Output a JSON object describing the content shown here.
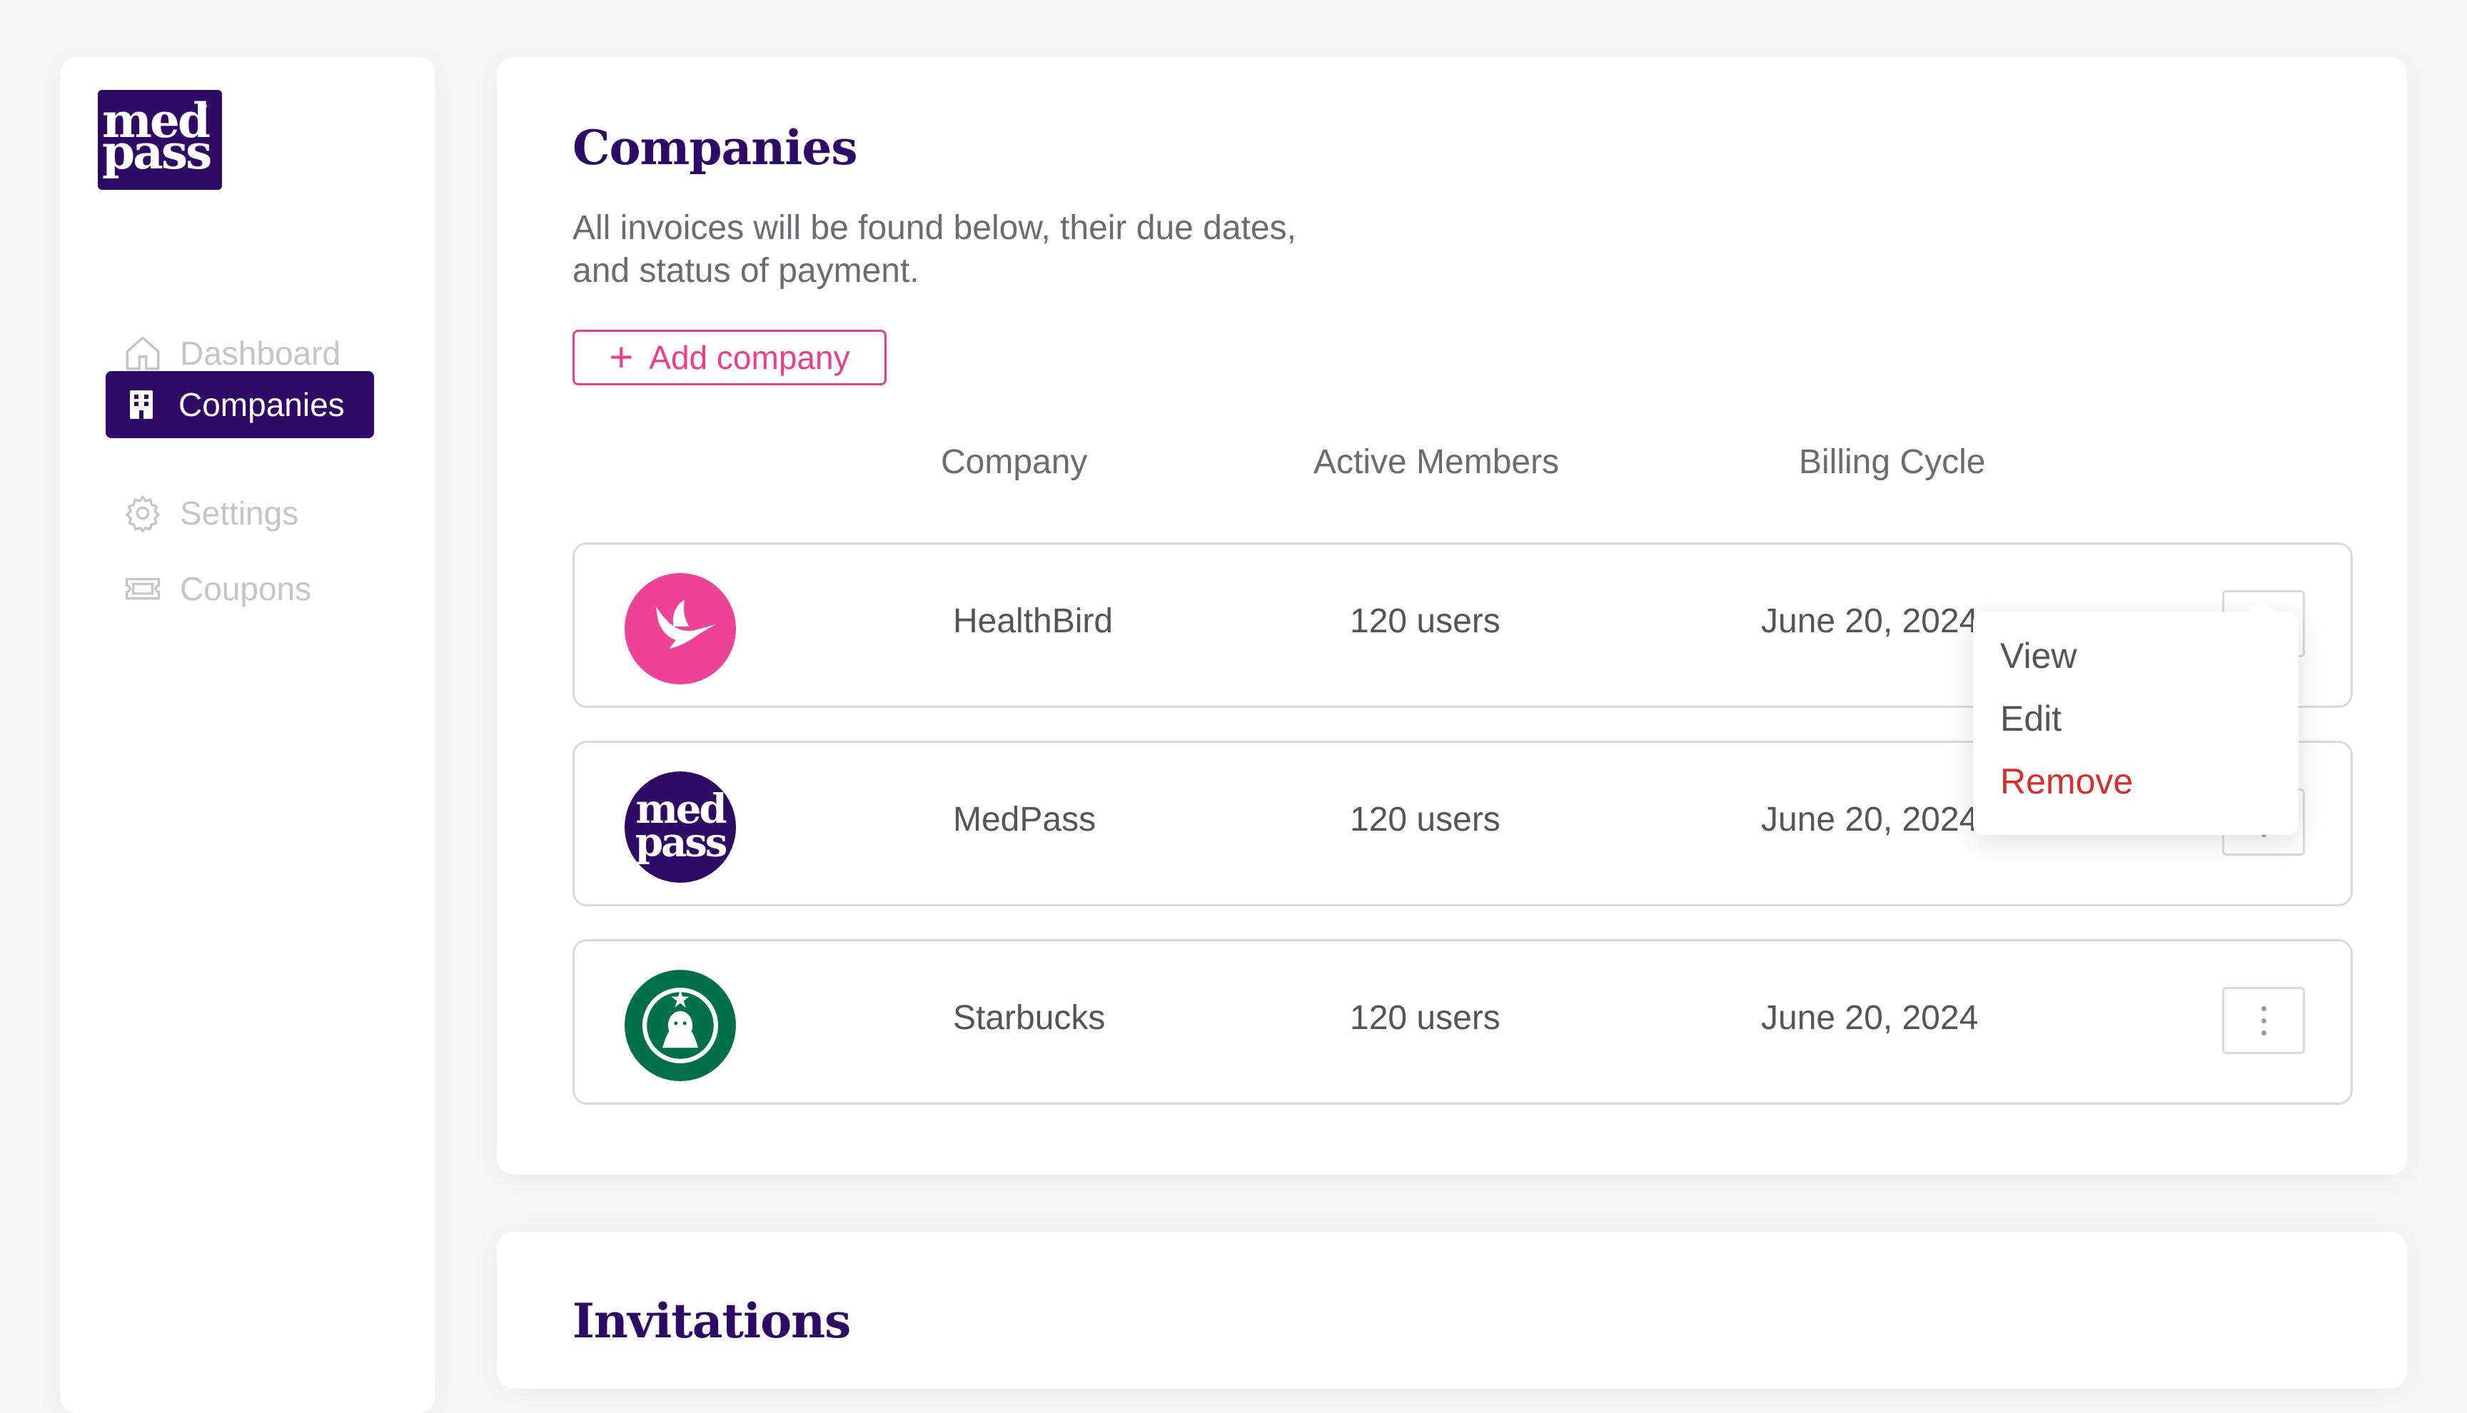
{
  "brand": {
    "logo_line1": "med",
    "logo_line2": "pass",
    "logo_tm": "™"
  },
  "sidebar": {
    "items": [
      {
        "label": "Dashboard",
        "icon": "home-icon",
        "active": false
      },
      {
        "label": "Companies",
        "icon": "building-icon",
        "active": true
      },
      {
        "label": "Settings",
        "icon": "gear-icon",
        "active": false
      },
      {
        "label": "Coupons",
        "icon": "ticket-icon",
        "active": false
      }
    ]
  },
  "companies": {
    "title": "Companies",
    "subtitle_line1": "All invoices will be found below, their due dates,",
    "subtitle_line2": "and status of payment.",
    "add_label": "Add company",
    "columns": [
      "Company",
      "Active Members",
      "Billing Cycle"
    ],
    "rows": [
      {
        "name": "HealthBird",
        "members": "120 users",
        "billing": "June 20, 2024",
        "logo": "hummingbird-logo",
        "color": "#ee4297"
      },
      {
        "name": "MedPass",
        "members": "120 users",
        "billing": "June 20, 2024",
        "logo": "medpass-logo",
        "color": "#2e0a66"
      },
      {
        "name": "Starbucks",
        "members": "120 users",
        "billing": "June 20, 2024",
        "logo": "starbucks-logo",
        "color": "#00704a"
      }
    ]
  },
  "menu": {
    "items": [
      "View",
      "Edit",
      "Remove"
    ]
  },
  "invitations": {
    "title": "Invitations"
  },
  "colors": {
    "brand": "#2e0a66",
    "accent": "#e8408a",
    "danger": "#d32f2f"
  }
}
